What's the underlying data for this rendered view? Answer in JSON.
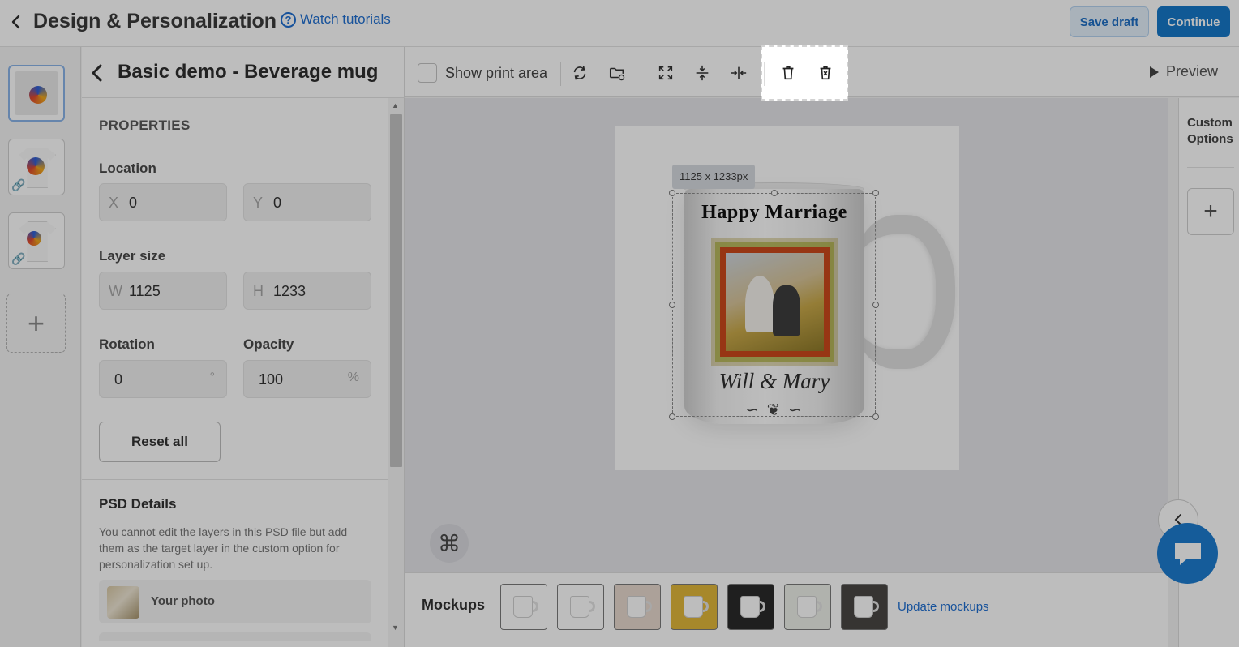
{
  "header": {
    "title": "Design & Personalization",
    "tutorials_label": "Watch tutorials",
    "save_draft_label": "Save draft",
    "continue_label": "Continue"
  },
  "panel": {
    "title": "Basic demo - Beverage mug",
    "section": "PROPERTIES",
    "location": {
      "label": "Location",
      "x_prefix": "X",
      "x": "0",
      "y_prefix": "Y",
      "y": "0"
    },
    "layer_size": {
      "label": "Layer size",
      "w_prefix": "W",
      "w": "1125",
      "h_prefix": "H",
      "h": "1233"
    },
    "rotation": {
      "label": "Rotation",
      "value": "0",
      "unit": "°"
    },
    "opacity": {
      "label": "Opacity",
      "value": "100",
      "unit": "%"
    },
    "reset_label": "Reset all",
    "psd": {
      "title": "PSD Details",
      "description": "You cannot edit the layers in this PSD file but add them as the target layer in the custom option for personalization set up.",
      "layers": [
        "Your photo"
      ]
    }
  },
  "toolbar": {
    "show_print_area": "Show print area",
    "preview": "Preview",
    "tools": [
      "refresh-icon",
      "replace-folder-icon",
      "fit-icon",
      "align-vertical-center-icon",
      "align-horizontal-center-icon",
      "delete-icon",
      "delete-all-icon"
    ]
  },
  "canvas": {
    "dimension_badge": "1125 x 1233px",
    "mug_title": "Happy Marriage",
    "mug_names": "Will & Mary",
    "shortcut_glyph": "⌘"
  },
  "custom_options": {
    "title_line1": "Custom",
    "title_line2": "Options",
    "add_glyph": "+"
  },
  "mockups": {
    "label": "Mockups",
    "update_label": "Update mockups",
    "backgrounds": [
      "#ffffff",
      "#ffffff",
      "#e8d9cf",
      "#e2b83a",
      "#2b2b2b",
      "#eef0ea",
      "#4a4744"
    ]
  },
  "colors": {
    "accent": "#1678c9",
    "link": "#1f6fd1",
    "frame": "#cc4a1c"
  }
}
